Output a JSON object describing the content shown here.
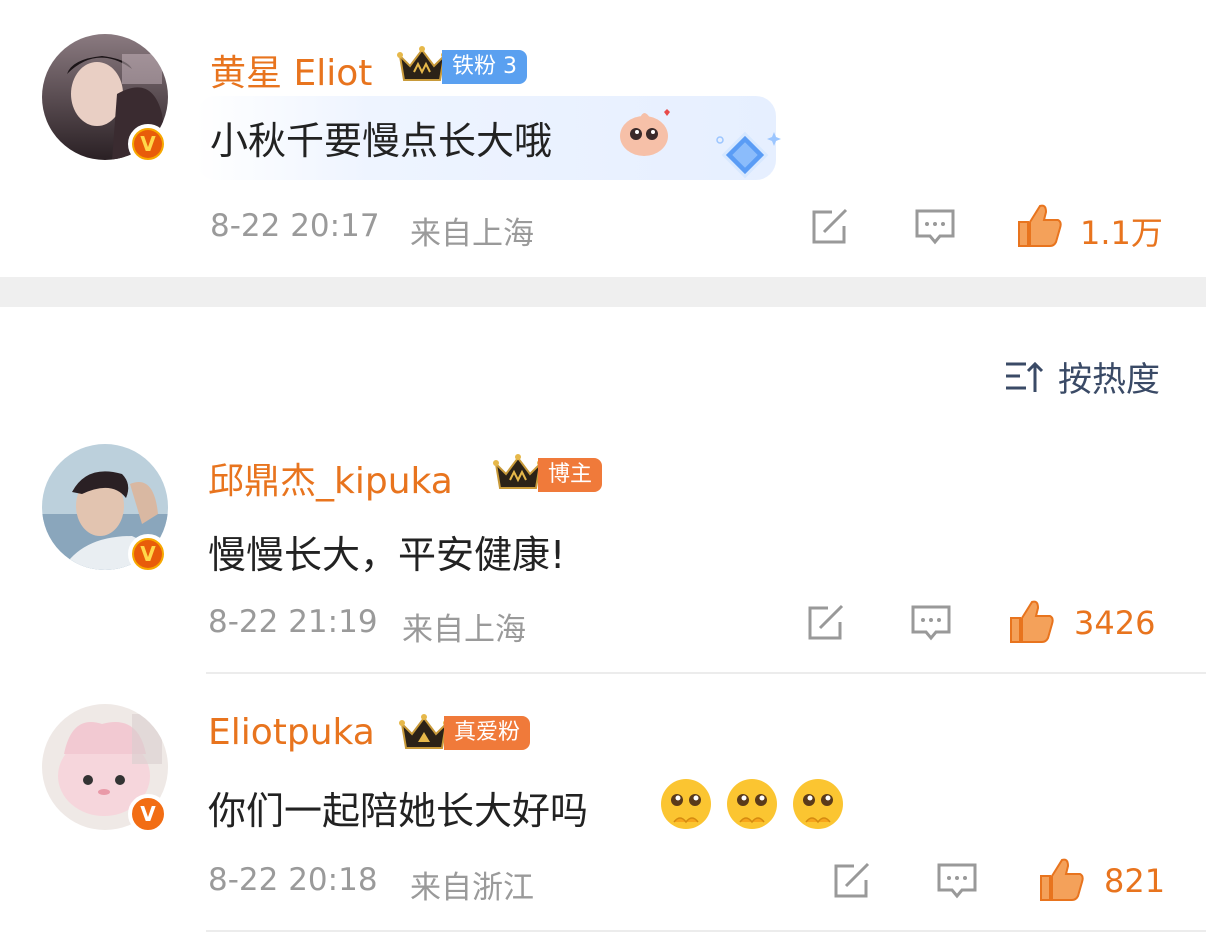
{
  "top_comment": {
    "username": "黄星 Eliot",
    "tag": "铁粉 3",
    "text": "小秋千要慢点长大哦",
    "date_time": "8-22 20:17",
    "location": "来自上海",
    "likes": "1.1万"
  },
  "sort": {
    "label": "按热度"
  },
  "comments": [
    {
      "username": "邱鼎杰_kipuka",
      "tag": "博主",
      "text": "慢慢长大，平安健康!",
      "date_time": "8-22 21:19",
      "location": "来自上海",
      "likes": "3426"
    },
    {
      "username": "Eliotpuka",
      "tag": "真爱粉",
      "text": "你们一起陪她长大好吗",
      "date_time": "8-22 20:18",
      "location": "来自浙江",
      "likes": "821"
    }
  ],
  "icons": {
    "share": "share-icon",
    "comment": "comment-icon",
    "like": "like-icon",
    "crown": "crown-icon",
    "verified": "verified-badge-icon",
    "sort": "sort-icon"
  },
  "colors": {
    "username": "#e8741e",
    "like_active": "#e8741e",
    "meta": "#9a9a9a",
    "tag_blue": "#5aa0f0",
    "tag_orange": "#f07a3a",
    "sort_text": "#3a4a66"
  }
}
